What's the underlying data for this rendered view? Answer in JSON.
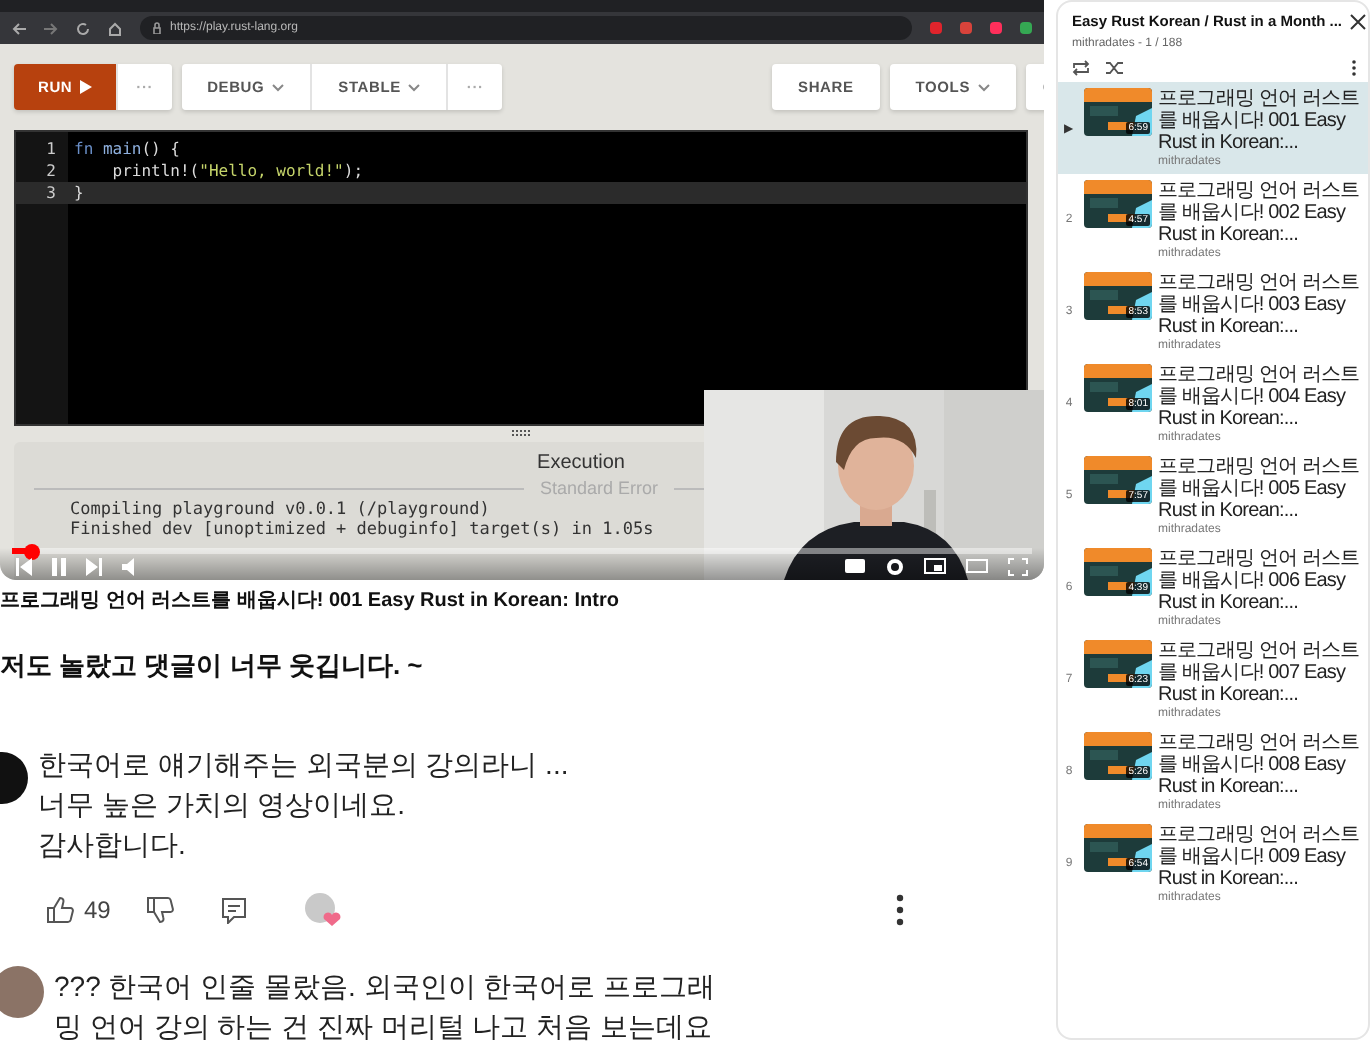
{
  "browser": {
    "url": "https://play.rust-lang.org"
  },
  "playground": {
    "toolbar_left": [
      {
        "label": "RUN",
        "kind": "run"
      },
      {
        "label": "···",
        "kind": "more"
      }
    ],
    "toolbar_middle": [
      {
        "label": "DEBUG",
        "kind": "dropdown"
      },
      {
        "label": "STABLE",
        "kind": "dropdown"
      },
      {
        "label": "···",
        "kind": "more"
      }
    ],
    "toolbar_right": [
      {
        "label": "SHARE",
        "kind": "plain"
      },
      {
        "label": "TOOLS",
        "kind": "dropdown"
      },
      {
        "kind": "config"
      }
    ],
    "code_lines": [
      {
        "number": "1",
        "active": false,
        "tokens": [
          {
            "text": "fn",
            "kind": "keyword"
          },
          {
            "text": " main",
            "kind": "function"
          },
          {
            "text": "() {",
            "kind": "plain"
          }
        ]
      },
      {
        "number": "2",
        "active": false,
        "tokens": [
          {
            "text": "    println!",
            "kind": "macro"
          },
          {
            "text": "(",
            "kind": "plain"
          },
          {
            "text": "\"Hello, world!\"",
            "kind": "string"
          },
          {
            "text": ");",
            "kind": "plain"
          }
        ]
      },
      {
        "number": "3",
        "active": true,
        "tokens": [
          {
            "text": "}",
            "kind": "plain"
          }
        ]
      }
    ],
    "output": {
      "title": "Execution",
      "section": "Standard Error",
      "lines": [
        "Compiling playground v0.0.1 (/playground)",
        "Finished dev [unoptimized + debuginfo] target(s) in 1.05s"
      ]
    }
  },
  "player": {
    "progress": {
      "level": 0.02
    }
  },
  "video_title": "프로그래밍 언어 러스트를 배웁시다! 001 Easy Rust in Korean: Intro",
  "playlist": {
    "title": "Easy Rust Korean / Rust in a Month ...",
    "subtitle": "mithradates - 1 / 188",
    "items": [
      {
        "index": "▶",
        "title": "프로그래밍 언어 러스트를 배웁시다! 001 Easy Rust in Korean:...",
        "channel": "mithradates",
        "duration": "6:59",
        "selected": true
      },
      {
        "index": "2",
        "title": "프로그래밍 언어 러스트를 배웁시다! 002 Easy Rust in Korean:...",
        "channel": "mithradates",
        "duration": "4:57",
        "selected": false
      },
      {
        "index": "3",
        "title": "프로그래밍 언어 러스트를 배웁시다! 003 Easy Rust in Korean:...",
        "channel": "mithradates",
        "duration": "8:53",
        "selected": false
      },
      {
        "index": "4",
        "title": "프로그래밍 언어 러스트를 배웁시다! 004 Easy Rust in Korean:...",
        "channel": "mithradates",
        "duration": "8:01",
        "selected": false
      },
      {
        "index": "5",
        "title": "프로그래밍 언어 러스트를 배웁시다! 005 Easy Rust in Korean:...",
        "channel": "mithradates",
        "duration": "7:57",
        "selected": false
      },
      {
        "index": "6",
        "title": "프로그래밍 언어 러스트를 배웁시다! 006 Easy Rust in Korean:...",
        "channel": "mithradates",
        "duration": "4:39",
        "selected": false
      },
      {
        "index": "7",
        "title": "프로그래밍 언어 러스트를 배웁시다! 007 Easy Rust in Korean:...",
        "channel": "mithradates",
        "duration": "6:23",
        "selected": false
      },
      {
        "index": "8",
        "title": "프로그래밍 언어 러스트를 배웁시다! 008 Easy Rust in Korean:...",
        "channel": "mithradates",
        "duration": "5:26",
        "selected": false
      },
      {
        "index": "9",
        "title": "프로그래밍 언어 러스트를 배웁시다! 009 Easy Rust in Korean:...",
        "channel": "mithradates",
        "duration": "6:54",
        "selected": false
      }
    ]
  },
  "comments_heading": "저도 놀랐고 댓글이 너무 웃깁니다. ~",
  "comments": [
    {
      "lines": [
        "한국어로 얘기해주는 외국분의 강의라니 ...",
        "너무 높은 가치의 영상이네요.",
        "감사합니다."
      ],
      "likes": "49",
      "hearted": true
    },
    {
      "lines": [
        "??? 한국어 인줄 몰랐음. 외국인이 한국어로 프로그래",
        "밍 언어 강의 하는 건 진짜 머리털 나고 처음 보는데요"
      ]
    }
  ]
}
